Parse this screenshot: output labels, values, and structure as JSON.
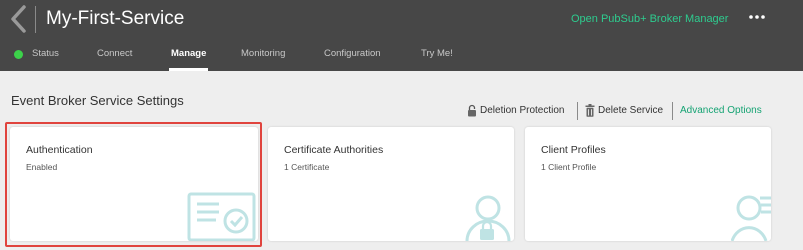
{
  "header": {
    "title": "My-First-Service",
    "broker_manager_link": "Open PubSub+ Broker Manager"
  },
  "tabs": [
    {
      "label": "Status",
      "active": false
    },
    {
      "label": "Connect",
      "active": false
    },
    {
      "label": "Manage",
      "active": true
    },
    {
      "label": "Monitoring",
      "active": false
    },
    {
      "label": "Configuration",
      "active": false
    },
    {
      "label": "Try Me!",
      "active": false
    }
  ],
  "status_color": "#3cd24a",
  "main": {
    "section_title": "Event Broker Service Settings",
    "actions": {
      "deletion_protection": "Deletion Protection",
      "delete_service": "Delete Service",
      "advanced_options": "Advanced Options"
    },
    "cards": [
      {
        "title": "Authentication",
        "subtitle": "Enabled",
        "icon": "certificate-icon"
      },
      {
        "title": "Certificate Authorities",
        "subtitle": "1 Certificate",
        "icon": "user-lock-icon"
      },
      {
        "title": "Client Profiles",
        "subtitle": "1 Client Profile",
        "icon": "user-list-icon"
      }
    ]
  },
  "colors": {
    "header_bg": "#474747",
    "accent_green": "#2ecc8f",
    "icon_teal": "#bfe3e4",
    "highlight": "#e0443e"
  }
}
